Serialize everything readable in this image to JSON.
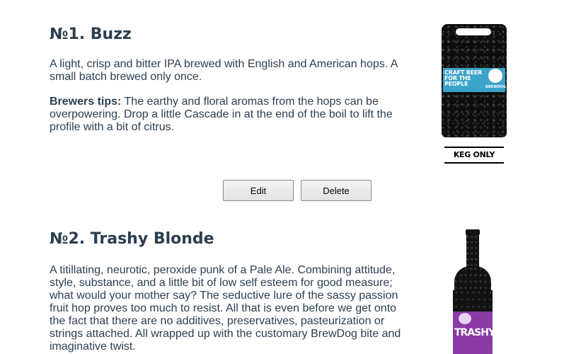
{
  "beers": [
    {
      "title": "№1. Buzz",
      "description": "A light, crisp and bitter IPA brewed with English and American hops. A small batch brewed only once.",
      "tips_label": "Brewers tips:",
      "tips": "The earthy and floral aromas from the hops can be overpowering. Drop a little Cascade in at the end of the boil to lift the profile with a bit of citrus.",
      "image": {
        "kind": "keg",
        "label_text": "CRAFT BEER FOR THE PEOPLE",
        "brand_text": "BREWDOG",
        "caption": "KEG ONLY",
        "colors": {
          "body": "#0e0e0e",
          "band": "#3aa3c8"
        }
      },
      "actions": {
        "edit_label": "Edit",
        "delete_label": "Delete"
      }
    },
    {
      "title": "№2. Trashy Blonde",
      "description": "A titillating, neurotic, peroxide punk of a Pale Ale. Combining attitude, style, substance, and a little bit of low self esteem for good measure; what would your mother say? The seductive lure of the sassy passion fruit hop proves too much to resist. All that is even before we get onto the fact that there are no additives, preservatives, pasteurization or strings attached. All wrapped up with the customary BrewDog bite and imaginative twist.",
      "image": {
        "kind": "bottle",
        "label_text": "TRASHY",
        "colors": {
          "body": "#121212",
          "label": "#8a3aa5"
        }
      }
    }
  ],
  "colors": {
    "text": "#2c3e50",
    "button_border": "#8a8a8a"
  }
}
